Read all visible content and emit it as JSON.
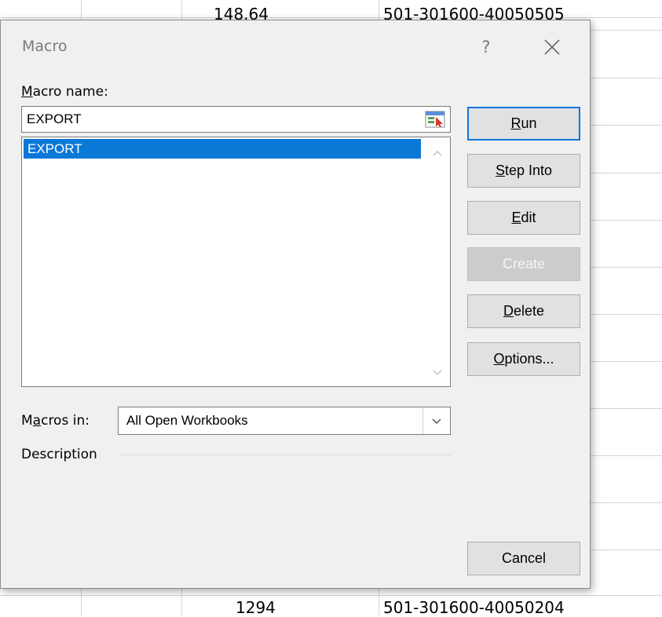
{
  "spreadsheet": {
    "top_row": {
      "amount": "148.64",
      "code": "501-301600-40050505"
    },
    "bottom_row": {
      "amount": "1294",
      "code": "501-301600-40050204"
    }
  },
  "dialog": {
    "title": "Macro",
    "help_glyph": "?",
    "close_icon": "close-icon",
    "macro_name_label_prefix": "M",
    "macro_name_label_rest": "acro name:",
    "macro_name_value": "EXPORT",
    "macro_list": [
      "EXPORT"
    ],
    "selected_index": 0,
    "buttons": {
      "run": {
        "accel": "R",
        "rest": "un"
      },
      "step_into": {
        "accel": "S",
        "rest": "tep Into"
      },
      "edit": {
        "accel": "E",
        "rest": "dit"
      },
      "create": {
        "label": "Create",
        "disabled": true
      },
      "delete": {
        "accel": "D",
        "rest": "elete"
      },
      "options": {
        "accel": "O",
        "rest": "ptions..."
      },
      "cancel": {
        "label": "Cancel"
      }
    },
    "macros_in_label_pre": "M",
    "macros_in_label_accel": "a",
    "macros_in_label_post": "cros in:",
    "macros_in_value": "All Open Workbooks",
    "description_label": "Description",
    "colors": {
      "accent": "#0a78d7",
      "dialog_bg": "#f0f0f0"
    }
  }
}
